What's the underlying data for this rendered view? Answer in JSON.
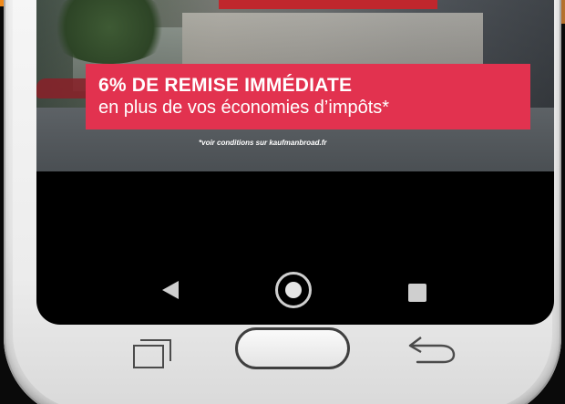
{
  "promo": {
    "headline": "6% DE REMISE IMMÉDIATE",
    "subline": "en plus de vos économies d’impôts*",
    "disclaimer": "*voir conditions sur kaufmanbroad.fr"
  },
  "colors": {
    "promo_background": "#e2324f",
    "promo_text": "#ffffff",
    "top_bar_accent": "#f08a1c",
    "phone_body": "#ececec",
    "screen_background": "#000000"
  },
  "icons": {
    "soft_back": "back-triangle-icon",
    "soft_home": "home-circle-icon",
    "soft_recents": "recents-square-icon",
    "hardware_recents": "recent-apps-icon",
    "hardware_home": "home-button",
    "hardware_back": "back-arrow-icon"
  }
}
